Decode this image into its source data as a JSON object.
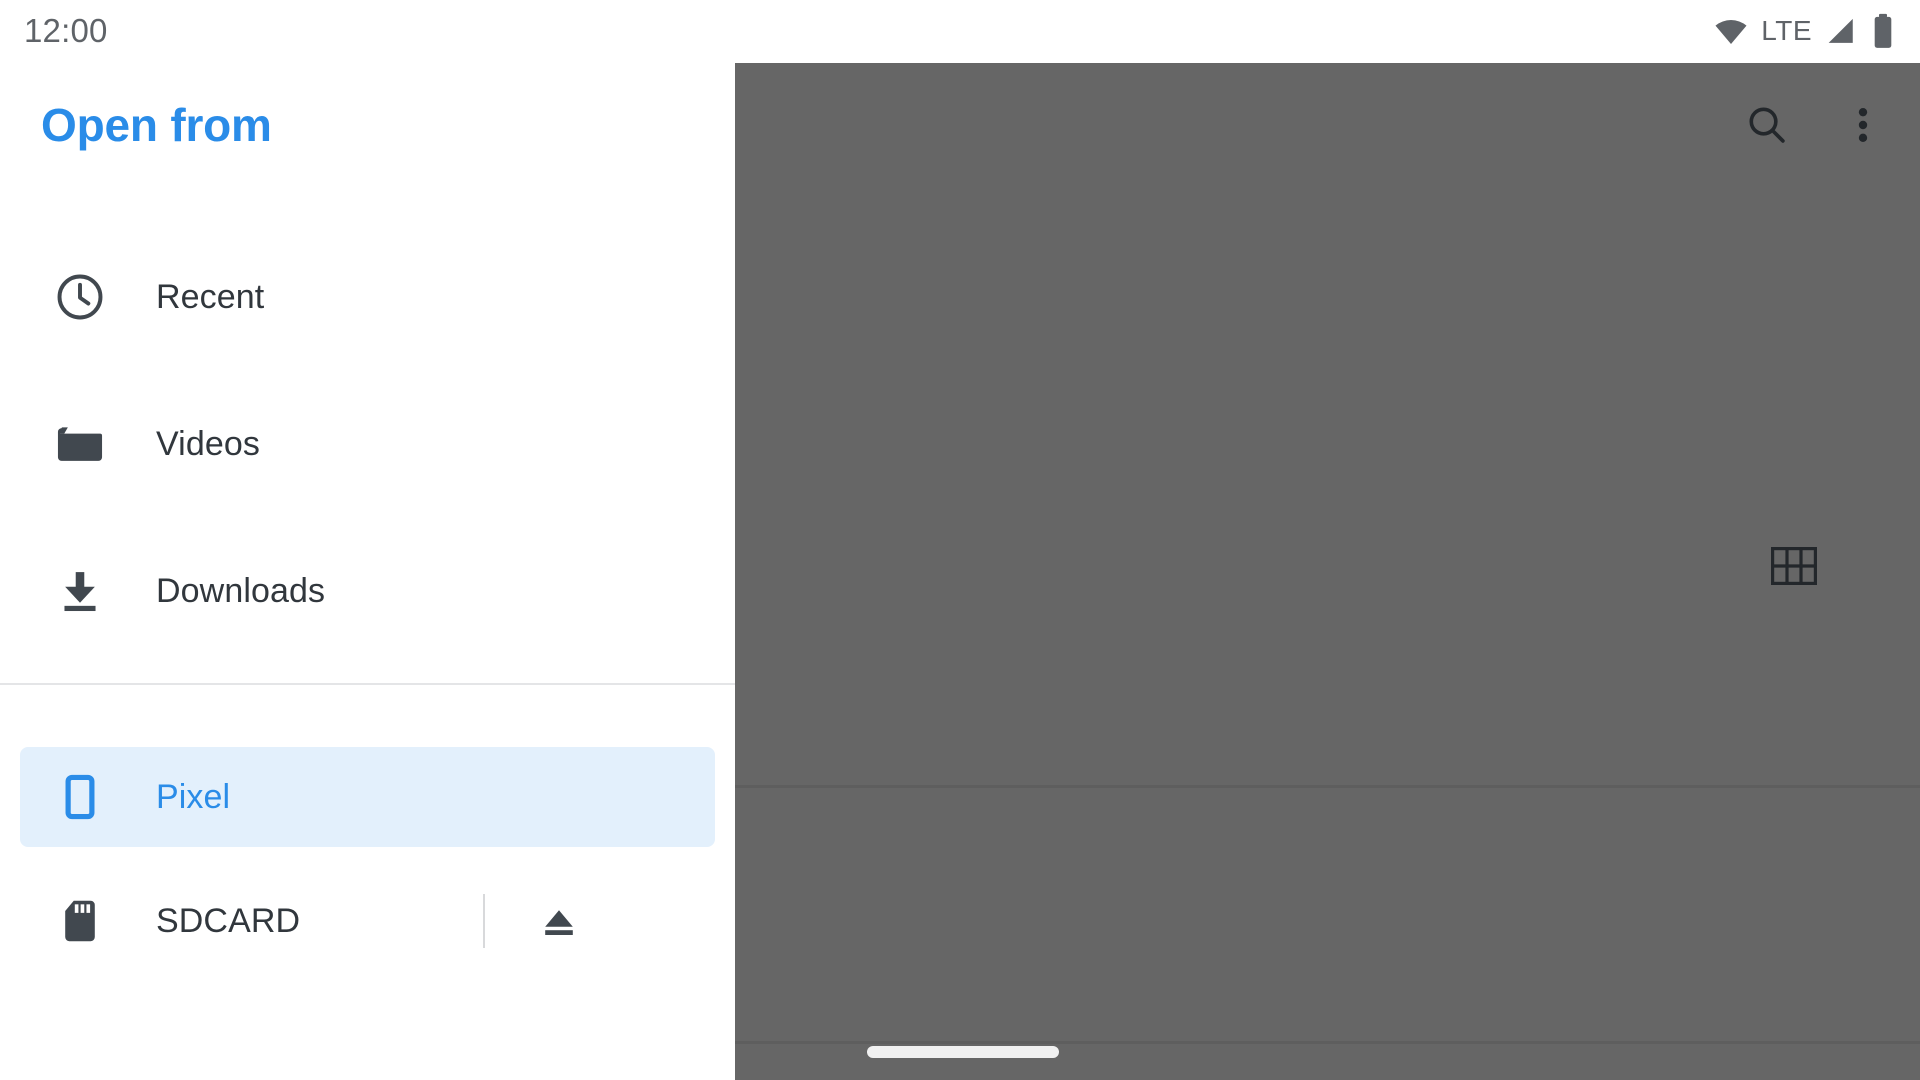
{
  "status_bar": {
    "clock": "12:00",
    "network_label": "LTE",
    "icons": [
      "wifi-icon",
      "signal-icon",
      "battery-icon"
    ]
  },
  "drawer": {
    "title": "Open from",
    "primary_items": [
      {
        "label": "Recent",
        "icon": "clock-icon",
        "selected": false
      },
      {
        "label": "Videos",
        "icon": "movie-clapper-icon",
        "selected": false
      },
      {
        "label": "Downloads",
        "icon": "download-icon",
        "selected": false
      }
    ],
    "secondary_items": [
      {
        "label": "Pixel",
        "icon": "phone-icon",
        "selected": true
      },
      {
        "label": "SDCARD",
        "icon": "sd-card-icon",
        "selected": false,
        "eject_label": "Eject"
      }
    ]
  },
  "content": {
    "actions": [
      {
        "label": "Search",
        "icon": "search-icon"
      },
      {
        "label": "More options",
        "icon": "more-vert-icon"
      }
    ],
    "view_toggle": {
      "label": "Grid view",
      "icon": "grid-view-icon"
    },
    "home_indicator": "home-indicator"
  },
  "colors": {
    "accent": "#2a8ce8",
    "selected_row_background": "#e3f0fc",
    "icon_dark": "#41484f",
    "scrim": "#666666",
    "status_text": "#5f6368",
    "divider": "#e4e5e7"
  }
}
